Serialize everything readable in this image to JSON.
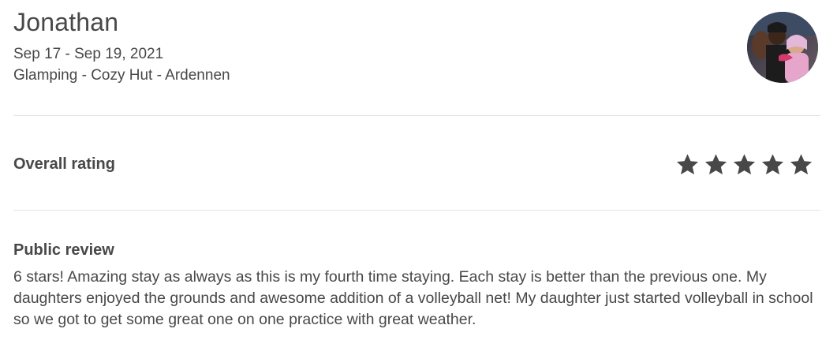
{
  "guest": {
    "name": "Jonathan",
    "dates": "Sep 17 - Sep 19, 2021",
    "listing": "Glamping - Cozy Hut - Ardennen"
  },
  "rating": {
    "label": "Overall rating",
    "stars": 5,
    "max_stars": 5,
    "star_color": "#484848"
  },
  "review": {
    "label": "Public review",
    "text": "6 stars! Amazing stay as always as this is my fourth time staying. Each stay is better than the previous one. My daughters enjoyed the grounds and awesome addition of a volleyball net! My daughter just started volleyball in school so we got to get some great one on one practice with great weather."
  }
}
